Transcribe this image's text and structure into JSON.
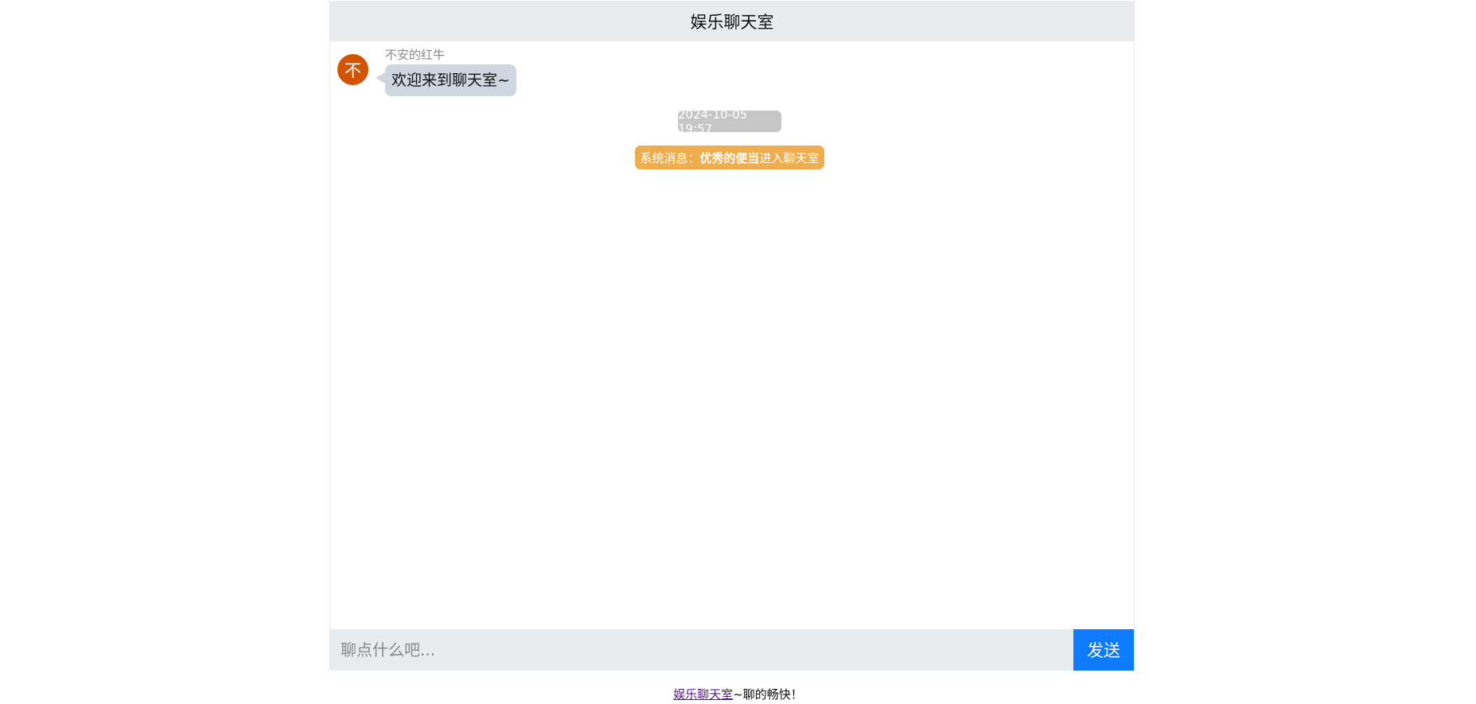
{
  "header": {
    "title": "娱乐聊天室"
  },
  "messages": [
    {
      "avatar_text": "不",
      "username": "不安的红牛",
      "text": "欢迎来到聊天室~"
    }
  ],
  "timestamp": "2024-10-05 19:57",
  "system_message": {
    "prefix": "系统消息：",
    "name": "优秀的便当",
    "suffix": "进入聊天室"
  },
  "composer": {
    "placeholder": "聊点什么吧...",
    "value": "",
    "send_label": "发送"
  },
  "footer": {
    "link_text": "娱乐聊天室",
    "tagline": "~聊的畅快！"
  },
  "colors": {
    "header_bg": "#e9ecef",
    "avatar_bg": "#d35400",
    "bubble_bg": "#cfd6df",
    "time_pill_bg": "#c6c6c6",
    "system_pill_bg": "#f0ad4e",
    "send_button_bg": "#0d7bff"
  }
}
